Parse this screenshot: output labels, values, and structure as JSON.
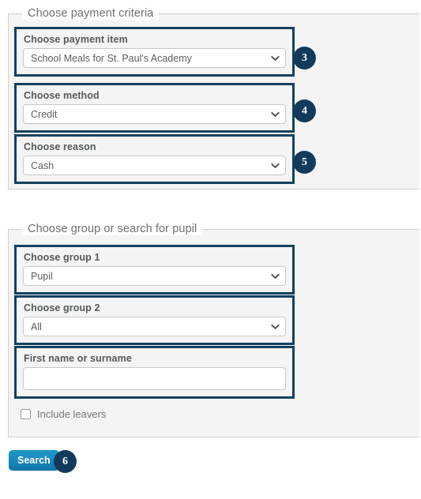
{
  "colors": {
    "accent_navy": "#123a5c",
    "panel_bg": "#f4f4f4",
    "panel_border": "#cfcfcf",
    "highlight_border": "#13405f",
    "button_blue_top": "#1e96c8",
    "button_blue_bottom": "#0e74a8",
    "label_text": "#55585c",
    "legend_text": "#6d6f74"
  },
  "panels": [
    {
      "id": "criteria",
      "legend": "Choose payment criteria",
      "fields": [
        {
          "label": "Choose payment item",
          "type": "select",
          "value": "School Meals for St. Paul's Academy",
          "badge": "3"
        },
        {
          "label": "Choose method",
          "type": "select",
          "value": "Credit",
          "badge": "4"
        },
        {
          "label": "Choose reason",
          "type": "select",
          "value": "Cash",
          "badge": "5"
        }
      ]
    },
    {
      "id": "group",
      "legend": "Choose group or search for pupil",
      "fields": [
        {
          "label": "Choose group 1",
          "type": "select",
          "value": "Pupil",
          "badge": ""
        },
        {
          "label": "Choose group 2",
          "type": "select",
          "value": "All",
          "badge": ""
        },
        {
          "label": "First name or surname",
          "type": "text",
          "value": "",
          "placeholder": "",
          "badge": ""
        }
      ],
      "checkbox": {
        "label": "Include leavers",
        "checked": false
      }
    }
  ],
  "actions": {
    "search_label": "Search",
    "search_badge": "6"
  },
  "icons": {
    "chevron": "chevron-down-icon"
  }
}
